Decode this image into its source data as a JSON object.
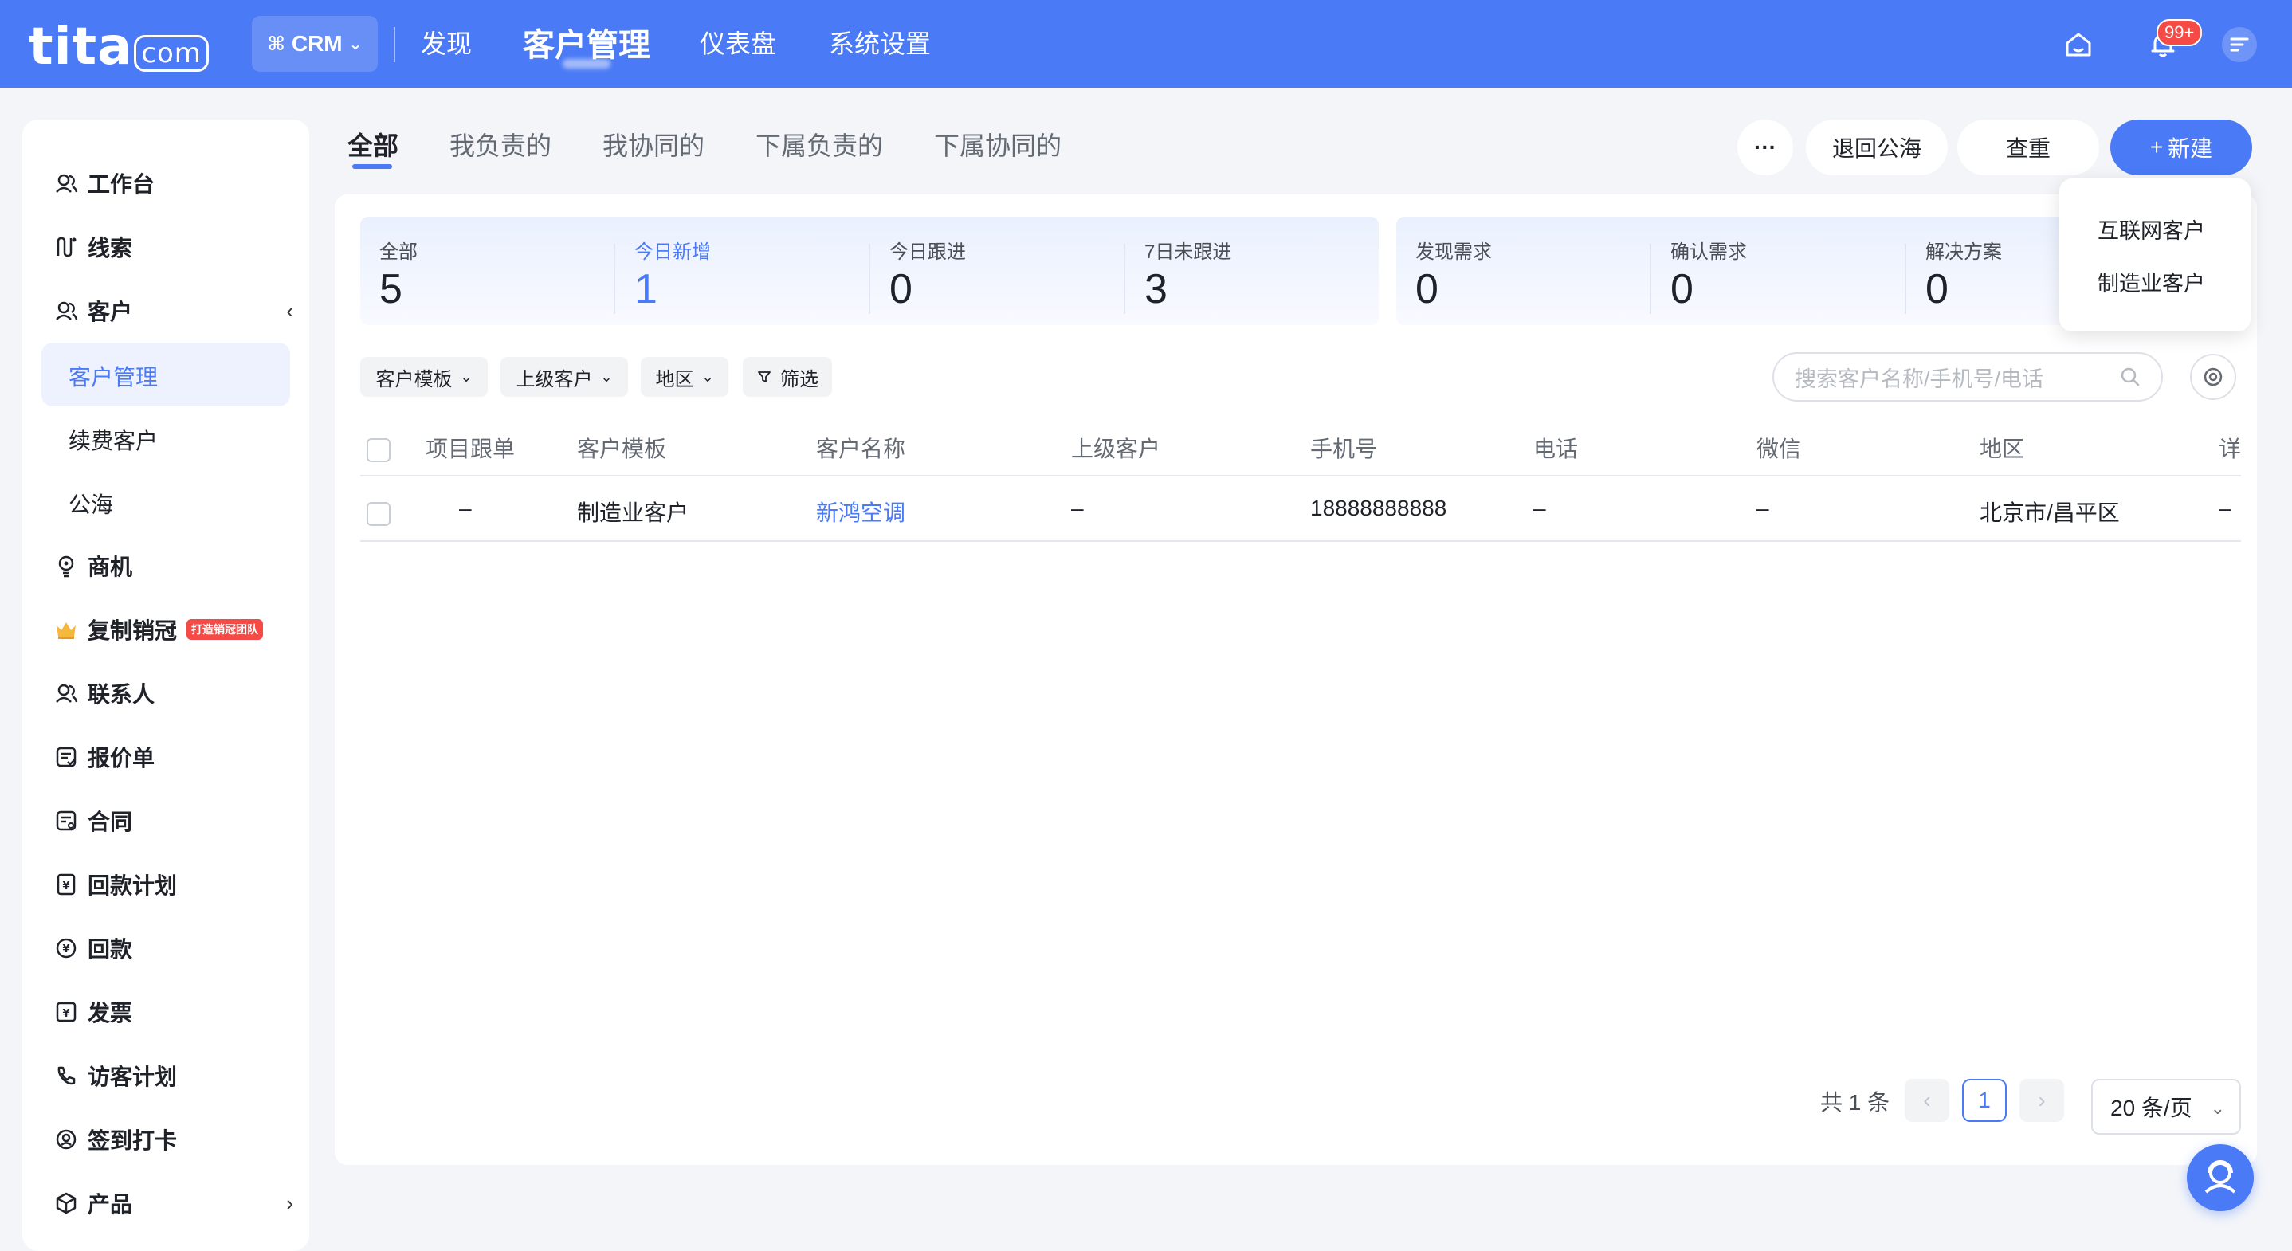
{
  "app": {
    "logo_main": "tita",
    "logo_suffix": "com",
    "module_switch": "CRM",
    "nav": [
      "发现",
      "客户管理",
      "仪表盘",
      "系统设置"
    ],
    "notification_badge": "99+"
  },
  "icons": {
    "module": "grid-icon",
    "home": "home-icon",
    "bell": "bell-icon",
    "menu": "menu-icon",
    "search": "search-icon",
    "settings": "gear-icon",
    "help": "customer-service-icon"
  },
  "colors": {
    "brand": "#4a7af5",
    "danger": "#f54a45",
    "link": "#4a7af5"
  },
  "sidebar": {
    "items": [
      {
        "label": "工作台",
        "icon": "users-icon"
      },
      {
        "label": "线索",
        "icon": "lead-icon"
      },
      {
        "label": "客户",
        "icon": "customer-icon",
        "arrow": "‹"
      },
      {
        "label": "商机",
        "icon": "bulb-icon"
      },
      {
        "label": "复制销冠",
        "icon": "crown-icon",
        "tag": "打造销冠团队"
      },
      {
        "label": "联系人",
        "icon": "contact-icon"
      },
      {
        "label": "报价单",
        "icon": "quote-icon"
      },
      {
        "label": "合同",
        "icon": "contract-icon"
      },
      {
        "label": "回款计划",
        "icon": "payment-plan-icon"
      },
      {
        "label": "回款",
        "icon": "payment-icon"
      },
      {
        "label": "发票",
        "icon": "invoice-icon"
      },
      {
        "label": "访客计划",
        "icon": "phone-icon"
      },
      {
        "label": "签到打卡",
        "icon": "location-icon"
      },
      {
        "label": "产品",
        "icon": "box-icon",
        "arrow": "›"
      }
    ],
    "sub_items": [
      "客户管理",
      "续费客户",
      "公海"
    ],
    "active_sub": "客户管理"
  },
  "tabs": [
    "全部",
    "我负责的",
    "我协同的",
    "下属负责的",
    "下属协同的"
  ],
  "actions": {
    "more": "···",
    "return_pool": "退回公海",
    "dedupe": "查重",
    "new": "新建",
    "new_icon": "+",
    "new_menu": [
      "互联网客户",
      "制造业客户"
    ]
  },
  "stats_group1": [
    {
      "label": "全部",
      "value": "5"
    },
    {
      "label": "今日新增",
      "value": "1"
    },
    {
      "label": "今日跟进",
      "value": "0"
    },
    {
      "label": "7日未跟进",
      "value": "3"
    }
  ],
  "stats_group2": [
    {
      "label": "发现需求",
      "value": "0"
    },
    {
      "label": "确认需求",
      "value": "0"
    },
    {
      "label": "解决方案",
      "value": "0"
    }
  ],
  "filters": [
    "客户模板",
    "上级客户",
    "地区",
    "筛选"
  ],
  "search": {
    "placeholder": "搜索客户名称/手机号/电话"
  },
  "table": {
    "columns": [
      "项目跟单",
      "客户模板",
      "客户名称",
      "上级客户",
      "手机号",
      "电话",
      "微信",
      "地区",
      "详"
    ],
    "rows": [
      [
        "–",
        "制造业客户",
        "新鸿空调",
        "–",
        "18888888888",
        "–",
        "–",
        "北京市/昌平区",
        "–"
      ]
    ]
  },
  "pagination": {
    "total": "共 1 条",
    "current": "1",
    "page_size": "20 条/页",
    "prev": "‹",
    "next": "›"
  }
}
